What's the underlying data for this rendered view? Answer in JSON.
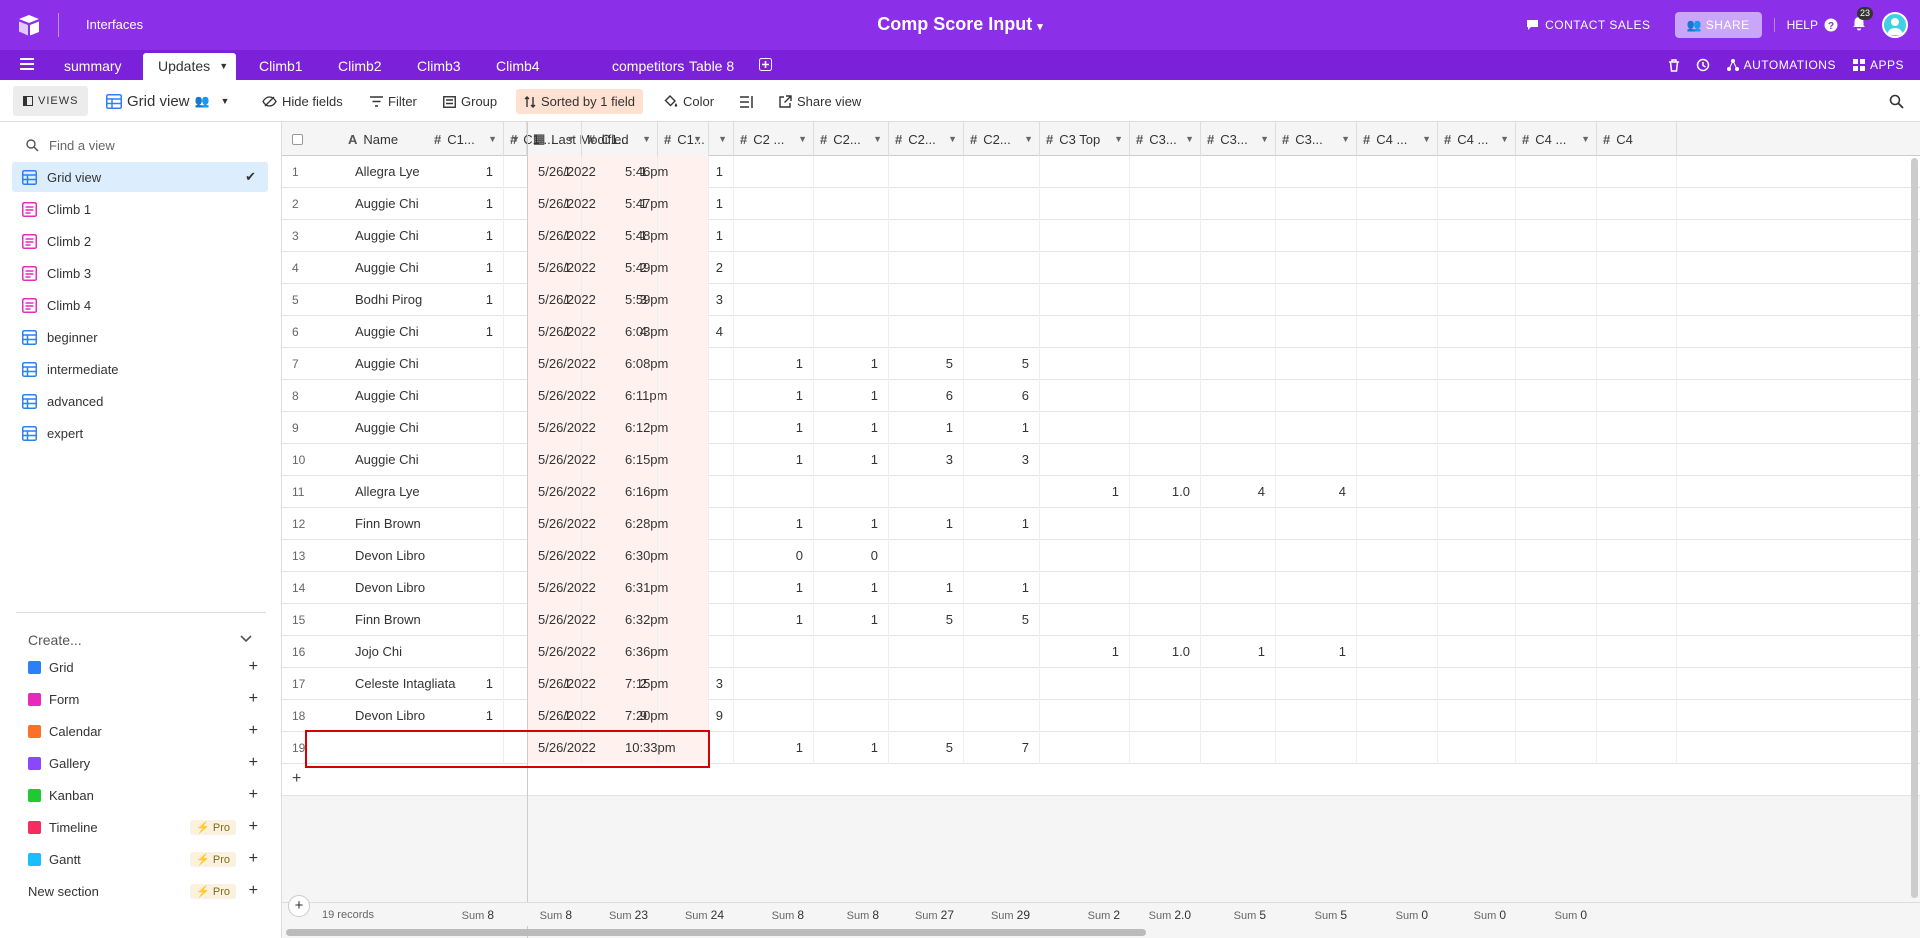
{
  "app": {
    "interfaces_label": "Interfaces",
    "base_title": "Comp Score Input",
    "title_caret": "▾"
  },
  "topbar": {
    "contact_sales": "CONTACT SALES",
    "share": "SHARE",
    "help": "HELP",
    "notification_count": "23",
    "accent": "#8b2fe8"
  },
  "tabs": [
    {
      "label": "summary",
      "active": false
    },
    {
      "label": "Updates",
      "active": true
    },
    {
      "label": "Climb1",
      "active": false
    },
    {
      "label": "Climb2",
      "active": false
    },
    {
      "label": "Climb3",
      "active": false
    },
    {
      "label": "Climb4",
      "active": false
    },
    {
      "label": "competitors",
      "active": false
    },
    {
      "label": "Table 8",
      "active": false
    }
  ],
  "tab_right": {
    "automations": "AUTOMATIONS",
    "apps": "APPS"
  },
  "viewbar": {
    "views": "VIEWS",
    "view_name": "Grid view",
    "hide_fields": "Hide fields",
    "filter": "Filter",
    "group": "Group",
    "sorted": "Sorted by 1 field",
    "color": "Color",
    "share_view": "Share view"
  },
  "sidebar": {
    "find_placeholder": "Find a view",
    "views": [
      {
        "label": "Grid view",
        "icon": "grid-icon",
        "active": true
      },
      {
        "label": "Climb 1",
        "icon": "form-icon",
        "active": false
      },
      {
        "label": "Climb 2",
        "icon": "form-icon",
        "active": false
      },
      {
        "label": "Climb 3",
        "icon": "form-icon",
        "active": false
      },
      {
        "label": "Climb 4",
        "icon": "form-icon",
        "active": false
      },
      {
        "label": "beginner",
        "icon": "grid-icon",
        "active": false
      },
      {
        "label": "intermediate",
        "icon": "grid-icon",
        "active": false
      },
      {
        "label": "advanced",
        "icon": "grid-icon",
        "active": false
      },
      {
        "label": "expert",
        "icon": "grid-icon",
        "active": false
      }
    ],
    "create_label": "Create...",
    "create_items": [
      {
        "label": "Grid",
        "color": "#2d7ff9",
        "pro": false
      },
      {
        "label": "Form",
        "color": "#e929ba",
        "pro": false
      },
      {
        "label": "Calendar",
        "color": "#ff6f2c",
        "pro": false
      },
      {
        "label": "Gallery",
        "color": "#8b46ff",
        "pro": false
      },
      {
        "label": "Kanban",
        "color": "#20c933",
        "pro": false
      },
      {
        "label": "Timeline",
        "color": "#f82b60",
        "pro": true
      },
      {
        "label": "Gantt",
        "color": "#18bfff",
        "pro": true
      },
      {
        "label": "New section",
        "color": "",
        "pro": true
      }
    ],
    "pro_label": "Pro"
  },
  "grid": {
    "columns": [
      "Name",
      "Last Modified",
      "C1...",
      "C1 ...",
      "C1...",
      "C1...",
      "C2 ...",
      "C2...",
      "C2...",
      "C2...",
      "C3 Top",
      "C3...",
      "C3...",
      "C3...",
      "C4 ...",
      "C4 ...",
      "C4 ...",
      "C4"
    ],
    "rows": [
      {
        "n": "1",
        "name": "Allegra Lye",
        "date": "5/26/2022",
        "time": "5:46pm",
        "v": [
          "1",
          "1",
          "1",
          "1",
          "",
          "",
          "",
          "",
          "",
          "",
          "",
          "",
          "",
          "",
          "",
          ""
        ]
      },
      {
        "n": "2",
        "name": "Auggie Chi",
        "date": "5/26/2022",
        "time": "5:47pm",
        "v": [
          "1",
          "1",
          "1",
          "1",
          "",
          "",
          "",
          "",
          "",
          "",
          "",
          "",
          "",
          "",
          "",
          ""
        ]
      },
      {
        "n": "3",
        "name": "Auggie Chi",
        "date": "5/26/2022",
        "time": "5:48pm",
        "v": [
          "1",
          "1",
          "1",
          "1",
          "",
          "",
          "",
          "",
          "",
          "",
          "",
          "",
          "",
          "",
          "",
          ""
        ]
      },
      {
        "n": "4",
        "name": "Auggie Chi",
        "date": "5/26/2022",
        "time": "5:49pm",
        "v": [
          "1",
          "1",
          "2",
          "2",
          "",
          "",
          "",
          "",
          "",
          "",
          "",
          "",
          "",
          "",
          "",
          ""
        ]
      },
      {
        "n": "5",
        "name": "Bodhi Pirog",
        "date": "5/26/2022",
        "time": "5:59pm",
        "v": [
          "1",
          "1",
          "3",
          "3",
          "",
          "",
          "",
          "",
          "",
          "",
          "",
          "",
          "",
          "",
          "",
          ""
        ]
      },
      {
        "n": "6",
        "name": "Auggie Chi",
        "date": "5/26/2022",
        "time": "6:03pm",
        "v": [
          "1",
          "1",
          "4",
          "4",
          "",
          "",
          "",
          "",
          "",
          "",
          "",
          "",
          "",
          "",
          "",
          ""
        ]
      },
      {
        "n": "7",
        "name": "Auggie Chi",
        "date": "5/26/2022",
        "time": "6:08pm",
        "v": [
          "",
          "",
          "",
          "",
          "1",
          "1",
          "5",
          "5",
          "",
          "",
          "",
          "",
          "",
          "",
          "",
          ""
        ]
      },
      {
        "n": "8",
        "name": "Auggie Chi",
        "date": "5/26/2022",
        "time": "6:11pm",
        "v": [
          "",
          "",
          "",
          "",
          "1",
          "1",
          "6",
          "6",
          "",
          "",
          "",
          "",
          "",
          "",
          "",
          ""
        ]
      },
      {
        "n": "9",
        "name": "Auggie Chi",
        "date": "5/26/2022",
        "time": "6:12pm",
        "v": [
          "",
          "",
          "",
          "",
          "1",
          "1",
          "1",
          "1",
          "",
          "",
          "",
          "",
          "",
          "",
          "",
          ""
        ]
      },
      {
        "n": "10",
        "name": "Auggie Chi",
        "date": "5/26/2022",
        "time": "6:15pm",
        "v": [
          "",
          "",
          "",
          "",
          "1",
          "1",
          "3",
          "3",
          "",
          "",
          "",
          "",
          "",
          "",
          "",
          ""
        ]
      },
      {
        "n": "11",
        "name": "Allegra Lye",
        "date": "5/26/2022",
        "time": "6:16pm",
        "v": [
          "",
          "",
          "",
          "",
          "",
          "",
          "",
          "",
          "1",
          "1.0",
          "4",
          "4",
          "",
          "",
          "",
          ""
        ]
      },
      {
        "n": "12",
        "name": "Finn Brown",
        "date": "5/26/2022",
        "time": "6:28pm",
        "v": [
          "",
          "",
          "",
          "",
          "1",
          "1",
          "1",
          "1",
          "",
          "",
          "",
          "",
          "",
          "",
          "",
          ""
        ]
      },
      {
        "n": "13",
        "name": "Devon Libro",
        "date": "5/26/2022",
        "time": "6:30pm",
        "v": [
          "",
          "",
          "",
          "",
          "0",
          "0",
          "",
          "",
          "",
          "",
          "",
          "",
          "",
          "",
          "",
          ""
        ]
      },
      {
        "n": "14",
        "name": "Devon Libro",
        "date": "5/26/2022",
        "time": "6:31pm",
        "v": [
          "",
          "",
          "",
          "",
          "1",
          "1",
          "1",
          "1",
          "",
          "",
          "",
          "",
          "",
          "",
          "",
          ""
        ]
      },
      {
        "n": "15",
        "name": "Finn Brown",
        "date": "5/26/2022",
        "time": "6:32pm",
        "v": [
          "",
          "",
          "",
          "",
          "1",
          "1",
          "5",
          "5",
          "",
          "",
          "",
          "",
          "",
          "",
          "",
          ""
        ]
      },
      {
        "n": "16",
        "name": "Jojo Chi",
        "date": "5/26/2022",
        "time": "6:36pm",
        "v": [
          "",
          "",
          "",
          "",
          "",
          "",
          "",
          "",
          "1",
          "1.0",
          "1",
          "1",
          "",
          "",
          "",
          ""
        ]
      },
      {
        "n": "17",
        "name": "Celeste Intagliata",
        "date": "5/26/2022",
        "time": "7:15pm",
        "v": [
          "1",
          "1",
          "2",
          "3",
          "",
          "",
          "",
          "",
          "",
          "",
          "",
          "",
          "",
          "",
          "",
          ""
        ]
      },
      {
        "n": "18",
        "name": "Devon Libro",
        "date": "5/26/2022",
        "time": "7:20pm",
        "v": [
          "1",
          "1",
          "9",
          "9",
          "",
          "",
          "",
          "",
          "",
          "",
          "",
          "",
          "",
          "",
          "",
          ""
        ]
      },
      {
        "n": "19",
        "name": "",
        "date": "5/26/2022",
        "time": "10:33pm",
        "v": [
          "",
          "",
          "",
          "",
          "1",
          "1",
          "5",
          "7",
          "",
          "",
          "",
          "",
          "",
          "",
          "",
          ""
        ]
      }
    ],
    "records_label": "19 records",
    "sum_label": "Sum",
    "sums": [
      "8",
      "8",
      "23",
      "24",
      "8",
      "8",
      "27",
      "29",
      "2",
      "2.0",
      "5",
      "5",
      "0",
      "0",
      "0",
      ""
    ]
  }
}
